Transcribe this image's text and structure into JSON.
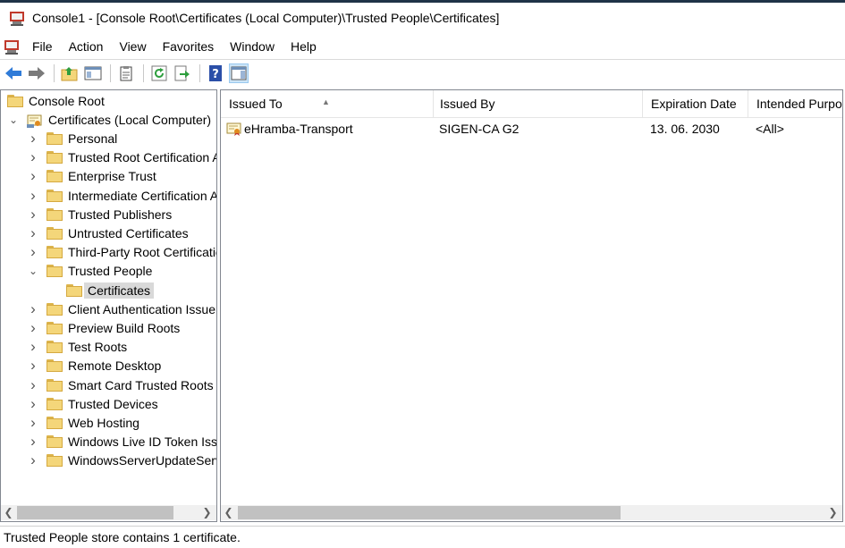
{
  "window": {
    "title": "Console1 - [Console Root\\Certificates (Local Computer)\\Trusted People\\Certificates]"
  },
  "menu": [
    "File",
    "Action",
    "View",
    "Favorites",
    "Window",
    "Help"
  ],
  "toolbar": {
    "buttons": [
      "back-arrow",
      "forward-arrow",
      "up-folder",
      "show-hide-console-tree",
      "properties",
      "refresh",
      "export-list",
      "help",
      "show-action-pane"
    ]
  },
  "tree": {
    "root": "Console Root",
    "certificates": "Certificates (Local Computer)",
    "stores": [
      {
        "label": "Personal",
        "state": "collapsed"
      },
      {
        "label": "Trusted Root Certification Authorities",
        "state": "collapsed"
      },
      {
        "label": "Enterprise Trust",
        "state": "collapsed"
      },
      {
        "label": "Intermediate Certification Authorities",
        "state": "collapsed"
      },
      {
        "label": "Trusted Publishers",
        "state": "collapsed"
      },
      {
        "label": "Untrusted Certificates",
        "state": "collapsed"
      },
      {
        "label": "Third-Party Root Certification Authorities",
        "state": "collapsed"
      },
      {
        "label": "Trusted People",
        "state": "expanded",
        "children": [
          {
            "label": "Certificates",
            "selected": true
          }
        ]
      },
      {
        "label": "Client Authentication Issuers",
        "state": "collapsed"
      },
      {
        "label": "Preview Build Roots",
        "state": "collapsed"
      },
      {
        "label": "Test Roots",
        "state": "collapsed"
      },
      {
        "label": "Remote Desktop",
        "state": "collapsed"
      },
      {
        "label": "Smart Card Trusted Roots",
        "state": "collapsed"
      },
      {
        "label": "Trusted Devices",
        "state": "collapsed"
      },
      {
        "label": "Web Hosting",
        "state": "collapsed"
      },
      {
        "label": "Windows Live ID Token Issuer",
        "state": "collapsed"
      },
      {
        "label": "WindowsServerUpdateServices",
        "state": "collapsed"
      }
    ]
  },
  "list": {
    "columns": [
      "Issued To",
      "Issued By",
      "Expiration Date",
      "Intended Purposes"
    ],
    "rows": [
      {
        "issued_to": "eHramba-Transport",
        "issued_by": "SIGEN-CA G2",
        "expiration": "13. 06. 2030",
        "purposes": "<All>"
      }
    ]
  },
  "status": "Trusted People store contains 1 certificate.",
  "colors": {
    "selection": "#d9d9d9",
    "folder": "#f4d67a",
    "toolbar_pressed": "#cce4f7"
  }
}
